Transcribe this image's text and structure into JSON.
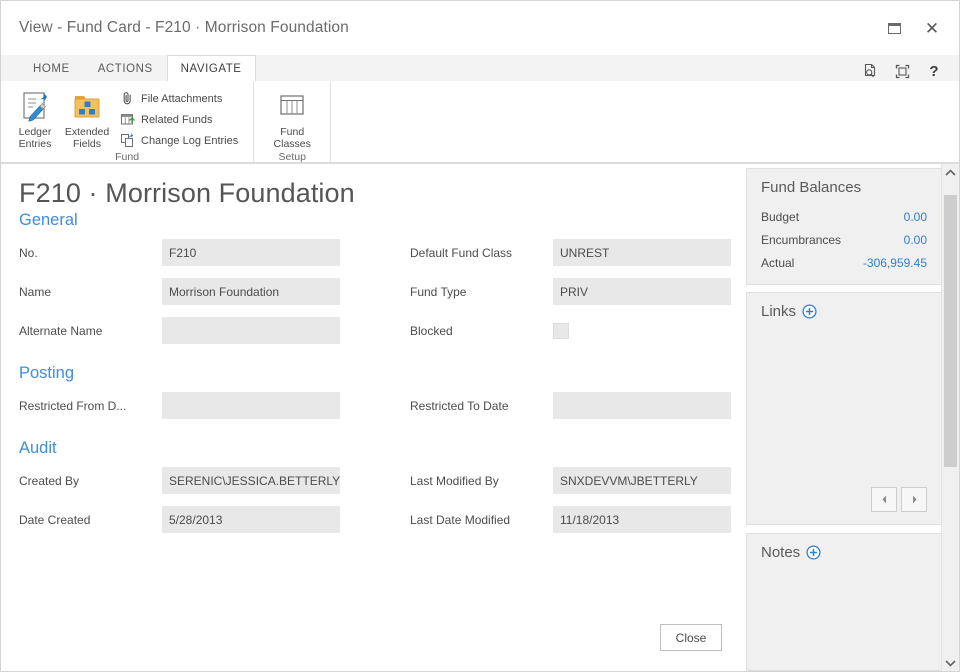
{
  "window": {
    "title": "View - Fund Card - F210 · Morrison Foundation",
    "restore_label": "restore-window",
    "close_label": "close-window"
  },
  "ribbon": {
    "tabs": [
      {
        "label": "HOME",
        "active": false
      },
      {
        "label": "ACTIONS",
        "active": false
      },
      {
        "label": "NAVIGATE",
        "active": true
      }
    ],
    "groups": [
      {
        "label": "Fund",
        "big_buttons": [
          {
            "label": "Ledger\nEntries",
            "line1": "Ledger",
            "line2": "Entries",
            "icon": "ledger-entries-icon"
          },
          {
            "label": "Extended\nFields",
            "line1": "Extended",
            "line2": "Fields",
            "icon": "extended-fields-icon"
          }
        ],
        "small_buttons": [
          {
            "label": "File Attachments",
            "icon": "paperclip-icon"
          },
          {
            "label": "Related Funds",
            "icon": "related-funds-icon"
          },
          {
            "label": "Change Log Entries",
            "icon": "change-log-icon"
          }
        ]
      },
      {
        "label": "Setup",
        "big_buttons": [
          {
            "label": "Fund Classes",
            "line1": "Fund",
            "line2": "Classes",
            "icon": "fund-classes-icon"
          }
        ],
        "small_buttons": []
      }
    ],
    "right_icons": [
      {
        "name": "preview-icon"
      },
      {
        "name": "fullscreen-icon"
      },
      {
        "name": "help-icon",
        "glyph": "?"
      }
    ]
  },
  "form": {
    "title": "F210 · Morrison Foundation",
    "sections": [
      {
        "heading": "General",
        "fields": [
          {
            "label": "No.",
            "value": "F210",
            "lookup": "...",
            "type": "text-lookup"
          },
          {
            "label": "Default Fund Class",
            "value": "UNREST",
            "type": "text"
          },
          {
            "label": "Name",
            "value": "Morrison Foundation",
            "type": "text"
          },
          {
            "label": "Fund Type",
            "value": "PRIV",
            "type": "text"
          },
          {
            "label": "Alternate Name",
            "value": "",
            "type": "text"
          },
          {
            "label": "Blocked",
            "value": "",
            "type": "checkbox",
            "checked": false
          }
        ]
      },
      {
        "heading": "Posting",
        "fields": [
          {
            "label": "Restricted From D...",
            "value": "",
            "type": "text"
          },
          {
            "label": "Restricted To Date",
            "value": "",
            "type": "text"
          }
        ]
      },
      {
        "heading": "Audit",
        "fields": [
          {
            "label": "Created By",
            "value": "SERENIC\\JESSICA.BETTERLY",
            "type": "text"
          },
          {
            "label": "Last Modified By",
            "value": "SNXDEVVM\\JBETTERLY",
            "type": "text"
          },
          {
            "label": "Date Created",
            "value": "5/28/2013",
            "type": "text"
          },
          {
            "label": "Last Date Modified",
            "value": "11/18/2013",
            "type": "text"
          }
        ]
      }
    ],
    "close_button": "Close"
  },
  "factbox": {
    "fund_balances": {
      "title": "Fund Balances",
      "rows": [
        {
          "key": "Budget",
          "value": "0.00"
        },
        {
          "key": "Encumbrances",
          "value": "0.00"
        },
        {
          "key": "Actual",
          "value": "-306,959.45"
        }
      ]
    },
    "links": {
      "title": "Links",
      "add_label": "add-link",
      "prev_label": "previous",
      "next_label": "next"
    },
    "notes": {
      "title": "Notes",
      "add_label": "add-note"
    }
  },
  "colors": {
    "accent": "#3e8ddd",
    "link": "#2f7fd0",
    "field_bg": "#e8e8e8",
    "factbox_bg": "#f0f0f0",
    "ribbon_bg": "#f3f3f3"
  }
}
